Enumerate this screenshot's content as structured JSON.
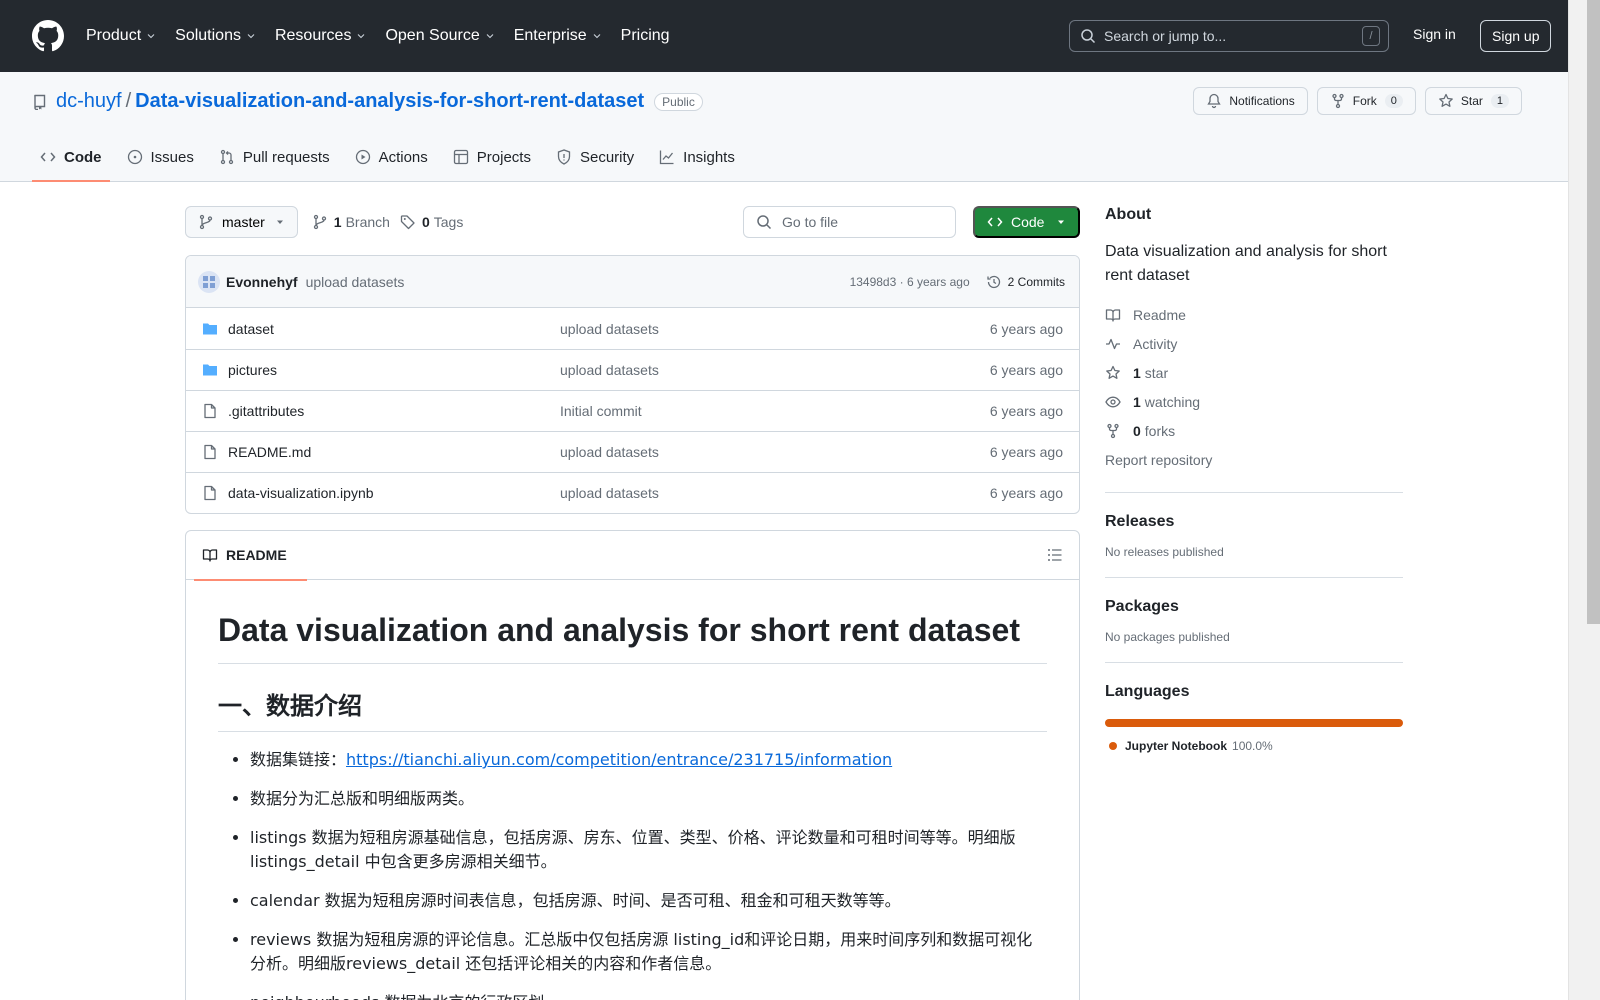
{
  "header": {
    "nav": [
      "Product",
      "Solutions",
      "Resources",
      "Open Source",
      "Enterprise",
      "Pricing"
    ],
    "search_placeholder": "Search or jump to...",
    "search_key": "/",
    "sign_in": "Sign in",
    "sign_up": "Sign up"
  },
  "repo": {
    "owner": "dc-huyf",
    "separator": "/",
    "name": "Data-visualization-and-analysis-for-short-rent-dataset",
    "visibility": "Public",
    "notifications": "Notifications",
    "fork_label": "Fork",
    "fork_count": "0",
    "star_label": "Star",
    "star_count": "1",
    "tabs": [
      "Code",
      "Issues",
      "Pull requests",
      "Actions",
      "Projects",
      "Security",
      "Insights"
    ]
  },
  "toolbar": {
    "branch": "master",
    "branch_count": "1",
    "branch_label": "Branch",
    "tag_count": "0",
    "tag_label": "Tags",
    "go_to_file": "Go to file",
    "code_button": "Code"
  },
  "commit": {
    "author": "Evonnehyf",
    "message": "upload datasets",
    "hash_time": "13498d3 · 6 years ago",
    "commits": "2 Commits"
  },
  "files": [
    {
      "type": "folder",
      "name": "dataset",
      "commit": "upload datasets",
      "age": "6 years ago"
    },
    {
      "type": "folder",
      "name": "pictures",
      "commit": "upload datasets",
      "age": "6 years ago"
    },
    {
      "type": "file",
      "name": ".gitattributes",
      "commit": "Initial commit",
      "age": "6 years ago"
    },
    {
      "type": "file",
      "name": "README.md",
      "commit": "upload datasets",
      "age": "6 years ago"
    },
    {
      "type": "file",
      "name": "data-visualization.ipynb",
      "commit": "upload datasets",
      "age": "6 years ago"
    }
  ],
  "readme": {
    "tab": "README",
    "h1": "Data visualization and analysis for short rent dataset",
    "h2": "一、数据介绍",
    "items": [
      {
        "prefix": "数据集链接：",
        "link": "https://tianchi.aliyun.com/competition/entrance/231715/information"
      },
      {
        "text": "数据分为汇总版和明细版两类。"
      },
      {
        "text": "listings 数据为短租房源基础信息，包括房源、房东、位置、类型、价格、评论数量和可租时间等等。明细版 listings_detail 中包含更多房源相关细节。"
      },
      {
        "text": "calendar 数据为短租房源时间表信息，包括房源、时间、是否可租、租金和可租天数等等。"
      },
      {
        "text": "reviews 数据为短租房源的评论信息。汇总版中仅包括房源 listing_id和评论日期，用来时间序列和数据可视化分析。明细版reviews_detail 还包括评论相关的内容和作者信息。"
      },
      {
        "text": "neighbourhoods 数据为北京的行政区划"
      }
    ]
  },
  "about": {
    "title": "About",
    "description": "Data visualization and analysis for short rent dataset",
    "readme": "Readme",
    "activity": "Activity",
    "stars_count": "1",
    "stars_label": "star",
    "watching_count": "1",
    "watching_label": "watching",
    "forks_count": "0",
    "forks_label": "forks",
    "report": "Report repository"
  },
  "releases": {
    "title": "Releases",
    "empty": "No releases published"
  },
  "packages": {
    "title": "Packages",
    "empty": "No packages published"
  },
  "languages": {
    "title": "Languages",
    "items": [
      {
        "name": "Jupyter Notebook",
        "percent": "100.0%",
        "value": 100,
        "color": "#DA5B0B"
      }
    ]
  },
  "colors": {
    "header_bg": "#24292f",
    "link": "#0969da",
    "green": "#1f883d",
    "tab_underline": "#fd8c73",
    "folder": "#54aeff"
  }
}
